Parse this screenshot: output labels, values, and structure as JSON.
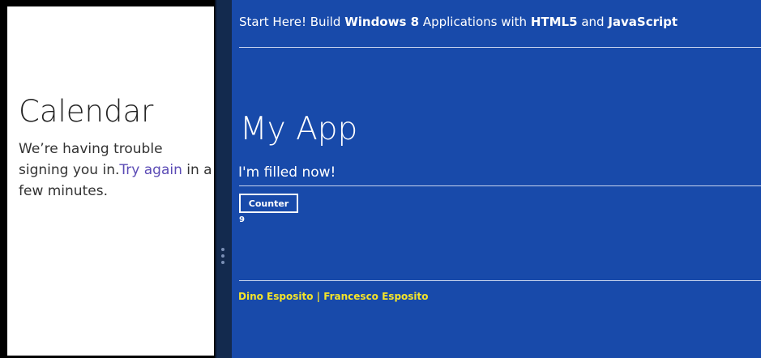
{
  "calendar": {
    "title": "Calendar",
    "message": "We’re having trouble signing you in.",
    "link": "Try again",
    "message_end": " in a few minutes."
  },
  "app": {
    "header": {
      "part1": "Start Here! Build ",
      "bold1": "Windows 8",
      "part2": " Applications with ",
      "bold2": "HTML5",
      "part3": " and ",
      "bold3": "JavaScript"
    },
    "title": "My App",
    "filled_message": "I'm filled now!",
    "counter_label": "Counter",
    "counter_value": "9",
    "authors": "Dino Esposito | Francesco Esposito"
  },
  "colors": {
    "app_background": "#184aaa",
    "splitter": "#132a4e",
    "link": "#5b4bb5",
    "authors": "#f4e42a"
  },
  "icons": {
    "splitter_grip": "vertical-dots-icon"
  }
}
